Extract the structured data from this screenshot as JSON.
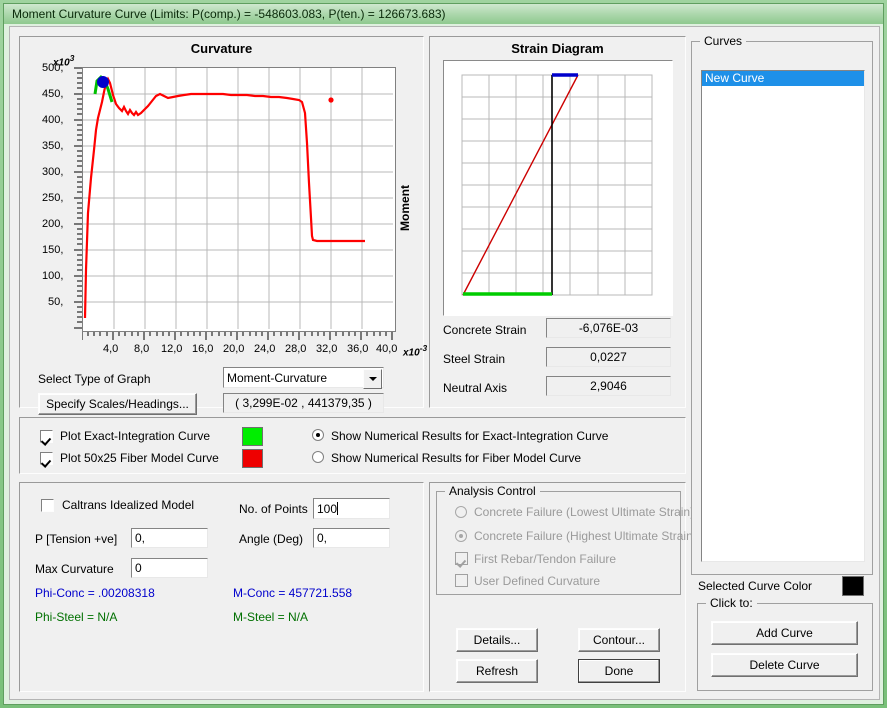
{
  "window": {
    "title": "Moment Curvature Curve (Limits:  P(comp.) = -548603.083, P(ten.) = 126673.683)"
  },
  "curvature_panel": {
    "title": "Curvature",
    "y_multiplier": "x10",
    "y_exponent": "3",
    "x_multiplier": "x10",
    "x_exponent": "-3",
    "y_ticks": [
      "500,",
      "450,",
      "400,",
      "350,",
      "300,",
      "250,",
      "200,",
      "150,",
      "100,",
      "50,"
    ],
    "x_ticks": [
      "4,0",
      "8,0",
      "12,0",
      "16,0",
      "20,0",
      "24,0",
      "28,0",
      "32,0",
      "36,0",
      "40,0"
    ],
    "axis_right_label": "Moment",
    "select_graph_label": "Select Type of Graph",
    "graph_type_value": "Moment-Curvature",
    "specify_button": "Specify Scales/Headings...",
    "coordinate_readout": "( 3,299E-02 , 441379,35 )"
  },
  "chart_data": {
    "type": "line",
    "title": "Curvature",
    "xlabel": "Curvature",
    "ylabel": "Moment",
    "xlim": [
      0,
      42
    ],
    "ylim": [
      0,
      520
    ],
    "x_scale_note": "x10^-3",
    "y_scale_note": "x10^3",
    "grid": true,
    "legend": "none",
    "series": [
      {
        "name": "50x25 Fiber Model Curve",
        "color": "#ff0000",
        "x": [
          0.2,
          0.5,
          0.9,
          1.3,
          1.7,
          2.1,
          2.5,
          2.9,
          3.3,
          3.7,
          4.1,
          4.6,
          5.2,
          5.8,
          6.4,
          7.0,
          7.6,
          8.2,
          8.8,
          9.4,
          10.2,
          11.0,
          12.0,
          13.0,
          13.6,
          14.4,
          15.5,
          17.0,
          19.0,
          21.0,
          23.0,
          25.0,
          27.0,
          29.0,
          30.0,
          30.3,
          30.4,
          30.6,
          31.0,
          33.0,
          35.0,
          37.0
        ],
        "y": [
          30,
          120,
          230,
          330,
          400,
          440,
          458,
          468,
          470,
          466,
          455,
          443,
          440,
          436,
          444,
          435,
          430,
          426,
          430,
          425,
          428,
          434,
          441,
          446,
          444,
          441,
          443,
          444,
          446,
          447,
          447,
          446,
          444,
          440,
          437,
          400,
          300,
          200,
          158,
          157,
          157,
          157
        ]
      },
      {
        "name": "Exact-Integration Curve",
        "color": "#00c000",
        "x": [
          2.4,
          2.9,
          3.3,
          3.7,
          4.0
        ],
        "y": [
          455,
          468,
          470,
          466,
          452
        ]
      }
    ],
    "markers": [
      {
        "name": "peak-marker",
        "x": 3.3,
        "y": 468,
        "color": "#0000cc",
        "size": 11
      },
      {
        "name": "isolated-point",
        "x": 33.9,
        "y": 449,
        "color": "#ff0000",
        "size": 4
      }
    ]
  },
  "strain_panel": {
    "title": "Strain Diagram",
    "rows": [
      {
        "label": "Concrete Strain",
        "value": "-6,076E-03"
      },
      {
        "label": "Steel Strain",
        "value": "0,0227"
      },
      {
        "label": "Neutral Axis",
        "value": "2,9046"
      }
    ],
    "colors": {
      "top": "#0000cc",
      "bottom": "#00cc00",
      "diagonal": "#cc0000",
      "axis": "#000000"
    }
  },
  "plot_options": {
    "checks": [
      {
        "label": "Plot Exact-Integration Curve",
        "checked": true,
        "color": "#00ee00"
      },
      {
        "label": "Plot 50x25 Fiber Model Curve",
        "checked": true,
        "color": "#ee0000"
      }
    ],
    "radios": [
      {
        "label": "Show Numerical Results for Exact-Integration Curve",
        "selected": true
      },
      {
        "label": "Show Numerical Results for Fiber Model Curve",
        "selected": false
      }
    ]
  },
  "params_panel": {
    "caltrans_label": "Caltrans Idealized Model",
    "caltrans_checked": false,
    "fields": [
      {
        "label": "P [Tension +ve]",
        "value": "0,"
      },
      {
        "label": "Max Curvature",
        "value": "0"
      },
      {
        "label": "No. of Points",
        "value": "100"
      },
      {
        "label": "Angle (Deg)",
        "value": "0,"
      }
    ],
    "results": [
      {
        "text": "Phi-Conc = .00208318",
        "color": "#0000cc"
      },
      {
        "text": "M-Conc = 457721.558",
        "color": "#0000cc"
      },
      {
        "text": "Phi-Steel = N/A",
        "color": "#007000"
      },
      {
        "text": "M-Steel = N/A",
        "color": "#007000"
      }
    ]
  },
  "analysis_control": {
    "title": "Analysis Control",
    "items": [
      {
        "type": "radio",
        "label": "Concrete Failure (Lowest Ultimate Strain)",
        "selected": false,
        "disabled": true
      },
      {
        "type": "radio",
        "label": "Concrete Failure (Highest Ultimate Strain)",
        "selected": true,
        "disabled": true
      },
      {
        "type": "check",
        "label": "First Rebar/Tendon Failure",
        "checked": true,
        "disabled": true
      },
      {
        "type": "check",
        "label": "User Defined Curvature",
        "checked": false,
        "disabled": true
      }
    ]
  },
  "action_buttons": {
    "details": "Details...",
    "contour": "Contour...",
    "refresh": "Refresh",
    "done": "Done"
  },
  "curves_panel": {
    "title": "Curves",
    "items": [
      {
        "label": "New Curve",
        "selected": true
      }
    ],
    "selected_color_label": "Selected Curve Color",
    "selected_color": "#000000",
    "click_to_title": "Click to:",
    "add_button": "Add Curve",
    "delete_button": "Delete Curve"
  }
}
